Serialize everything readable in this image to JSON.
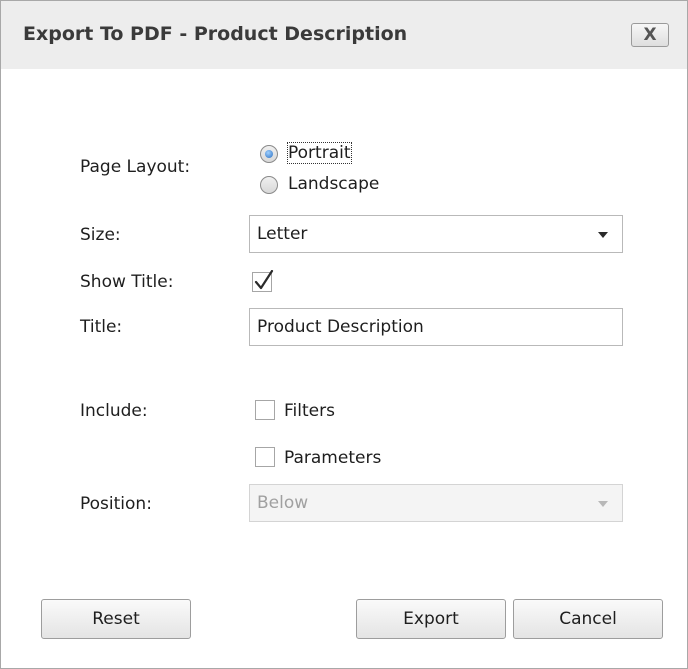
{
  "window": {
    "title": "Export To PDF - Product Description",
    "close_glyph": "X"
  },
  "page_layout": {
    "label": "Page Layout:",
    "options": [
      {
        "label": "Portrait",
        "selected": true
      },
      {
        "label": "Landscape",
        "selected": false
      }
    ]
  },
  "size": {
    "label": "Size:",
    "value": "Letter"
  },
  "show_title": {
    "label": "Show Title:",
    "checked": true
  },
  "title_field": {
    "label": "Title:",
    "value": "Product Description"
  },
  "include": {
    "label": "Include:",
    "options": [
      {
        "label": "Filters",
        "checked": false
      },
      {
        "label": "Parameters",
        "checked": false
      }
    ]
  },
  "position": {
    "label": "Position:",
    "value": "Below",
    "disabled": true
  },
  "buttons": {
    "reset": "Reset",
    "export": "Export",
    "cancel": "Cancel"
  },
  "colors": {
    "title_bar": "#ededed",
    "radio_selected": "#2b6fc1",
    "border": "#b9b9b9"
  },
  "icons": {
    "close": "close-icon",
    "dropdown": "chevron-down-icon",
    "check": "checkmark-icon"
  }
}
